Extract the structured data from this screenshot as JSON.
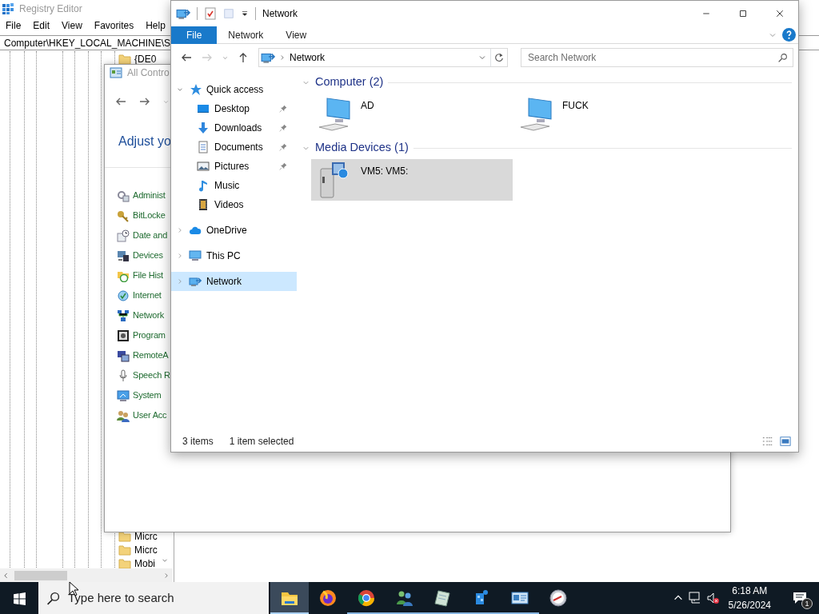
{
  "registry_editor": {
    "title": "Registry Editor",
    "menu": [
      "File",
      "Edit",
      "View",
      "Favorites",
      "Help"
    ],
    "address": "Computer\\HKEY_LOCAL_MACHINE\\S",
    "tree_top": "{DE0",
    "tree_bottom": [
      "Micrc",
      "Micrc",
      "Mobi"
    ]
  },
  "control_panel": {
    "title": "All Contro",
    "heading": "Adjust yo",
    "items": [
      "Administ",
      "BitLocke",
      "Date and",
      "Devices",
      "File Hist",
      "Internet",
      "Network",
      "Program",
      "RemoteA",
      "Speech R",
      "System",
      "User Acc"
    ]
  },
  "explorer": {
    "title": "Network",
    "ribbon_tabs": [
      {
        "label": "File",
        "selected": true
      },
      {
        "label": "Network",
        "selected": false
      },
      {
        "label": "View",
        "selected": false
      }
    ],
    "address": "Network",
    "search": {
      "placeholder": "Search Network"
    },
    "nav": [
      {
        "label": "Quick access",
        "expanded": true,
        "selected": false,
        "children": [
          {
            "label": "Desktop",
            "pinned": true,
            "selected": false
          },
          {
            "label": "Downloads",
            "pinned": true,
            "selected": false
          },
          {
            "label": "Documents",
            "pinned": true,
            "selected": false
          },
          {
            "label": "Pictures",
            "pinned": true,
            "selected": false
          },
          {
            "label": "Music",
            "pinned": false,
            "selected": false
          },
          {
            "label": "Videos",
            "pinned": false,
            "selected": false
          }
        ]
      },
      {
        "label": "OneDrive",
        "expanded": false,
        "selected": false
      },
      {
        "label": "This PC",
        "expanded": false,
        "selected": false
      },
      {
        "label": "Network",
        "expanded": false,
        "selected": true
      }
    ],
    "groups": [
      {
        "title": "Computer (2)",
        "expanded": true,
        "items": [
          {
            "name": "AD",
            "kind": "computer",
            "selected": false
          },
          {
            "name": "FUCK",
            "kind": "computer",
            "selected": false
          }
        ]
      },
      {
        "title": "Media Devices (1)",
        "expanded": true,
        "items": [
          {
            "name": "VM5: VM5:",
            "kind": "media",
            "selected": true
          }
        ]
      }
    ],
    "status": {
      "count": "3 items",
      "selection": "1 item selected"
    }
  },
  "taskbar": {
    "search": {
      "placeholder": "Type here to search"
    },
    "apps": [
      {
        "active": true,
        "running": true
      },
      {
        "active": false,
        "running": false
      },
      {
        "active": false,
        "running": true
      },
      {
        "active": false,
        "running": true
      },
      {
        "active": false,
        "running": true
      },
      {
        "active": false,
        "running": true
      },
      {
        "active": false,
        "running": true
      },
      {
        "active": false,
        "running": false
      }
    ],
    "time": "6:18 AM",
    "date": "5/26/2024",
    "notifications": "1"
  }
}
